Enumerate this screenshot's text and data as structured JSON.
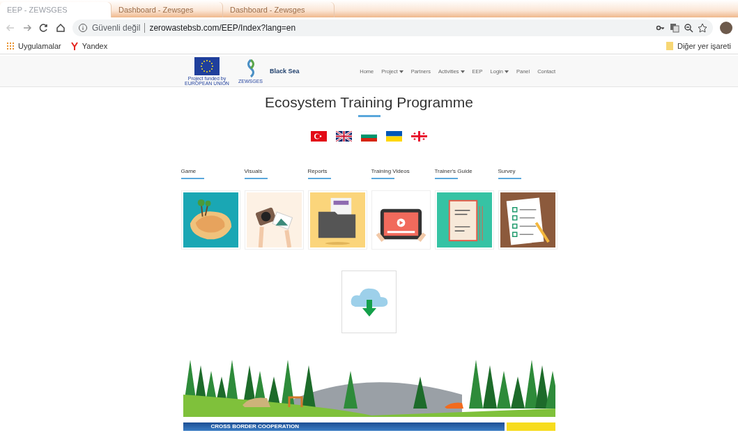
{
  "browser": {
    "tabs": [
      {
        "title": "EEP - ZEWSGES",
        "selected": true
      },
      {
        "title": "Dashboard - Zewsges",
        "selected": false
      },
      {
        "title": "Dashboard - Zewsges",
        "selected": false
      }
    ],
    "address": {
      "security": "Güvenli değil",
      "url": "zerowastebsb.com/EEP/Index?lang=en"
    },
    "bookmarks": [
      {
        "label": "Uygulamalar",
        "kind": "apps"
      },
      {
        "label": "Yandex",
        "kind": "yandex"
      }
    ],
    "other_bookmarks": "Diğer yer işareti"
  },
  "site": {
    "logo_caption": "Project funded by EUROPEAN UNION",
    "partner_logo": "ZEWSGES",
    "blacksea_logo": "Black Sea",
    "nav": [
      {
        "label": "Home",
        "dropdown": false
      },
      {
        "label": "Project",
        "dropdown": true
      },
      {
        "label": "Partners",
        "dropdown": false
      },
      {
        "label": "Activities",
        "dropdown": true
      },
      {
        "label": "EEP",
        "dropdown": false
      },
      {
        "label": "Login",
        "dropdown": true
      },
      {
        "label": "Panel",
        "dropdown": false
      },
      {
        "label": "Contact",
        "dropdown": false
      }
    ],
    "title": "Ecosystem Training Programme",
    "flags": [
      {
        "kind": "tr"
      },
      {
        "kind": "gb"
      },
      {
        "kind": "bg"
      },
      {
        "kind": "ua"
      },
      {
        "kind": "ge"
      }
    ],
    "sections": [
      {
        "label": "Game",
        "kind": "island"
      },
      {
        "label": "Visuals",
        "kind": "camera"
      },
      {
        "label": "Reports",
        "kind": "folder"
      },
      {
        "label": "Training Videos",
        "kind": "tablet"
      },
      {
        "label": "Trainer's Guide",
        "kind": "manual"
      },
      {
        "label": "Survey",
        "kind": "checklist"
      }
    ],
    "footer_banner": "CROSS BORDER COOPERATION"
  }
}
